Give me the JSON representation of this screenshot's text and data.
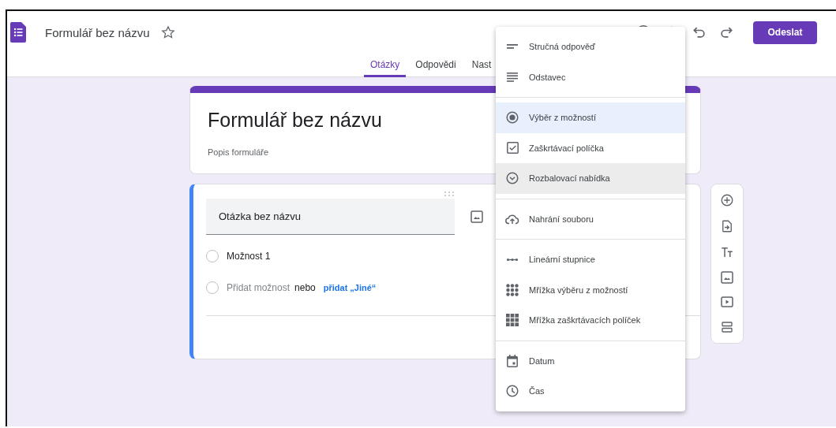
{
  "header": {
    "title": "Formulář bez názvu",
    "starred": false,
    "send_button": "Odeslat"
  },
  "tabs": [
    {
      "label": "Otázky",
      "selected": true
    },
    {
      "label": "Odpovědi",
      "selected": false
    },
    {
      "label": "Nast",
      "selected": false
    }
  ],
  "form_header": {
    "title": "Formulář bez názvu",
    "description_placeholder": "Popis formuláře"
  },
  "question": {
    "title_placeholder": "Otázka bez názvu",
    "options": [
      {
        "label": "Možnost 1",
        "selected": false
      }
    ],
    "add_option": "Přidat možnost",
    "add_option_selected": false,
    "or": "nebo",
    "add_other": "přidat „Jiné“"
  },
  "type_menu": {
    "groups": [
      [
        {
          "label": "Stručná odpověď",
          "kind": "short",
          "selected": false,
          "hovered": false
        },
        {
          "label": "Odstavec",
          "kind": "paragraph",
          "selected": false,
          "hovered": false
        }
      ],
      [
        {
          "label": "Výběr z možností",
          "kind": "radio",
          "selected": true,
          "hovered": false
        },
        {
          "label": "Zaškrtávací políčka",
          "kind": "checkbox",
          "selected": false,
          "hovered": false
        },
        {
          "label": "Rozbalovací nabídka",
          "kind": "dropdown",
          "selected": false,
          "hovered": true
        }
      ],
      [
        {
          "label": "Nahrání souboru",
          "kind": "upload",
          "selected": false,
          "hovered": false
        }
      ],
      [
        {
          "label": "Lineární stupnice",
          "kind": "linear",
          "selected": false,
          "hovered": false
        },
        {
          "label": "Mřížka výběru z možností",
          "kind": "radiogrid",
          "selected": false,
          "hovered": false
        },
        {
          "label": "Mřížka zaškrtávacích políček",
          "kind": "checkgrid",
          "selected": false,
          "hovered": false
        }
      ],
      [
        {
          "label": "Datum",
          "kind": "date",
          "selected": false,
          "hovered": false
        },
        {
          "label": "Čas",
          "kind": "time",
          "selected": false,
          "hovered": false
        }
      ]
    ]
  }
}
